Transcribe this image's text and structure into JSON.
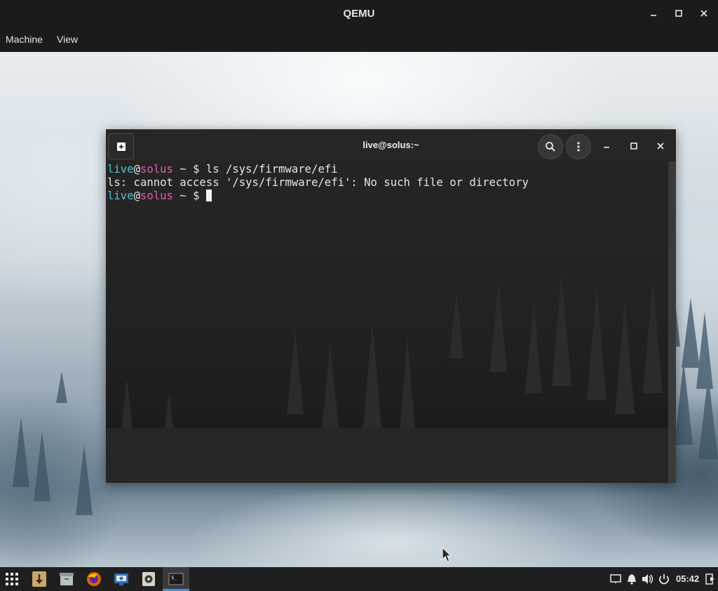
{
  "qemu": {
    "title": "QEMU",
    "menu": [
      "Machine",
      "View"
    ]
  },
  "terminal": {
    "title": "live@solus:~",
    "lines": [
      {
        "user": "live",
        "at": "@",
        "host": "solus",
        "rest": " ~ $ ls /sys/firmware/efi"
      },
      {
        "plain": "ls: cannot access '/sys/firmware/efi': No such file or directory"
      },
      {
        "user": "live",
        "at": "@",
        "host": "solus",
        "rest": " ~ $ "
      }
    ]
  },
  "taskbar": {
    "apps": [
      "app-grid-icon",
      "downloader-icon",
      "archive-manager-icon",
      "firefox-icon",
      "screen-recorder-icon",
      "rhythmbox-icon",
      "terminal-icon"
    ],
    "active_app": "terminal-icon",
    "clock": "05:42"
  },
  "colors": {
    "prompt_user": "#4fc3d7",
    "prompt_host": "#e05fb0",
    "taskbar_active_indicator": "#4a90d9"
  }
}
